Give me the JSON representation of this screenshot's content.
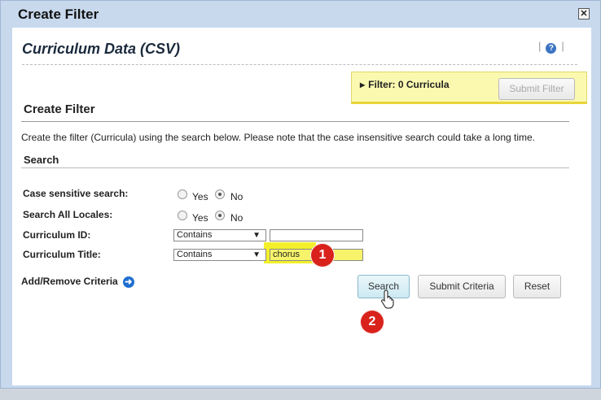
{
  "dialog": {
    "title": "Create Filter",
    "close_glyph": "✕"
  },
  "header": {
    "page_title": "Curriculum Data (CSV)",
    "help_glyph": "?"
  },
  "filter_box": {
    "label": "Filter:  0  Curricula",
    "submit_label": "Submit Filter",
    "submit_enabled": false
  },
  "create_filter": {
    "heading": "Create Filter",
    "description": "Create the filter (Curricula) using the search below. Please note that the case insensitive search could take a long time."
  },
  "search": {
    "heading": "Search",
    "case_sensitive": {
      "label": "Case sensitive search:",
      "yes": "Yes",
      "no": "No",
      "selected": "No"
    },
    "all_locales": {
      "label": "Search All Locales:",
      "yes": "Yes",
      "no": "No",
      "selected": "No"
    },
    "curriculum_id": {
      "label": "Curriculum ID:",
      "operator": "Contains",
      "value": ""
    },
    "curriculum_title": {
      "label": "Curriculum Title:",
      "operator": "Contains",
      "value": "chorus"
    },
    "add_remove_label": "Add/Remove Criteria",
    "buttons": {
      "search": "Search",
      "submit_criteria": "Submit Criteria",
      "reset": "Reset"
    }
  },
  "annotations": {
    "step1": "1",
    "step2": "2"
  },
  "icons": {
    "help": "help-icon",
    "add_remove": "arrow-right-circle-icon",
    "close": "close-icon",
    "cursor": "hand-pointer-icon"
  },
  "colors": {
    "dialog_bg": "#c8d9ee",
    "filter_box_bg": "#fbf8b0",
    "highlight": "#f3f02b",
    "step_badge": "#d9221c",
    "link_icon": "#1f6fd0"
  }
}
